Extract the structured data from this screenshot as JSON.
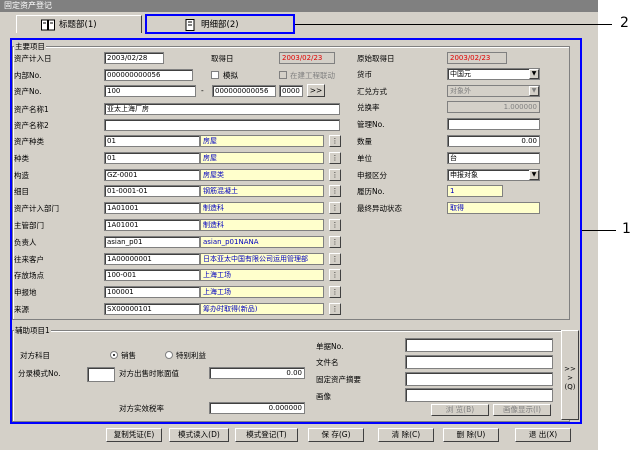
{
  "window": {
    "title": "固定资产登记"
  },
  "tabs": [
    {
      "label": "标题部(1)"
    },
    {
      "label": "明细部(2)"
    }
  ],
  "callouts": {
    "tabs": "2",
    "panel": "1"
  },
  "main": {
    "group_label": "主要项目",
    "left": {
      "rows": [
        {
          "label": "资产计入日",
          "value": "2003/02/28"
        },
        {
          "label": "内部No.",
          "value": "000000000056"
        },
        {
          "label": "资产No.",
          "value": "100",
          "dash": "-",
          "value2": "000000000056",
          "value3": "0000",
          "nav": ">>"
        },
        {
          "label": "资产名称1",
          "value": "亚太上海厂房"
        },
        {
          "label": "资产名称2",
          "value": ""
        }
      ],
      "mid": {
        "acq_label": "取得日",
        "acq_value": "2003/02/23",
        "model_label": "模拟",
        "link_label": "在建工程联动"
      },
      "coded": [
        {
          "label": "资产种类",
          "code": "01",
          "name": "房屋"
        },
        {
          "label": "种类",
          "code": "01",
          "name": "房屋"
        },
        {
          "label": "构造",
          "code": "GZ-0001",
          "name": "房屋类"
        },
        {
          "label": "细目",
          "code": "01-0001-01",
          "name": "钢筋混凝土"
        },
        {
          "label": "资产计入部门",
          "code": "1A01001",
          "name": "制造科"
        },
        {
          "label": "主管部门",
          "code": "1A01001",
          "name": "制造科"
        },
        {
          "label": "负责人",
          "code": "asian_p01",
          "name": "asian_p01NANA"
        },
        {
          "label": "往来客户",
          "code": "1A00000001",
          "name": "日本亚太中国有限公司运用管理部"
        },
        {
          "label": "存放场点",
          "code": "100-001",
          "name": "上海工场"
        },
        {
          "label": "申报地",
          "code": "100001",
          "name": "上海工场"
        },
        {
          "label": "来源",
          "code": "SX00000101",
          "name": "筹办时取得(新品)"
        }
      ],
      "search_btn": "⋮"
    },
    "right": {
      "orig_acq_label": "原始取得日",
      "orig_acq_value": "2003/02/23",
      "currency_label": "货币",
      "currency_value": "中国元",
      "sum_label": "汇兑方式",
      "sum_value": "对象外",
      "rate_label": "兑换率",
      "rate_value": "1.000000",
      "mgmt_label": "管理No.",
      "mgmt_value": "",
      "qty_label": "数量",
      "qty_value": "0.00",
      "unit_label": "单位",
      "unit_value": "台",
      "decl_label": "申报区分",
      "decl_value": "申报对象",
      "hist_label": "履历No.",
      "hist_value": "1",
      "final_label": "最终异动状态",
      "final_value": "取得"
    }
  },
  "aux": {
    "group_label": "辅助项目1",
    "subject_label": "对方科目",
    "radio1": "销售",
    "radio2": "特别利益",
    "mode_label": "分录模式No.",
    "mode_value": "",
    "sale_label": "对方出售时账面值",
    "sale_value": "0.00",
    "tax_label": "对方实效税率",
    "tax_value": "0.000000",
    "doc_label": "单据No.",
    "file_label": "文件名",
    "summary_label": "固定资产摘要",
    "image_label": "画像",
    "browse_btn": "浏 览(B)",
    "show_btn": "画像显示(I)",
    "more": ">>> (Q)"
  },
  "footer": {
    "buttons": [
      "复制凭证(E)",
      "模式读入(D)",
      "模式登记(T)",
      "保 存(G)",
      "清 除(C)",
      "删 除(U)",
      "退 出(X)"
    ]
  }
}
